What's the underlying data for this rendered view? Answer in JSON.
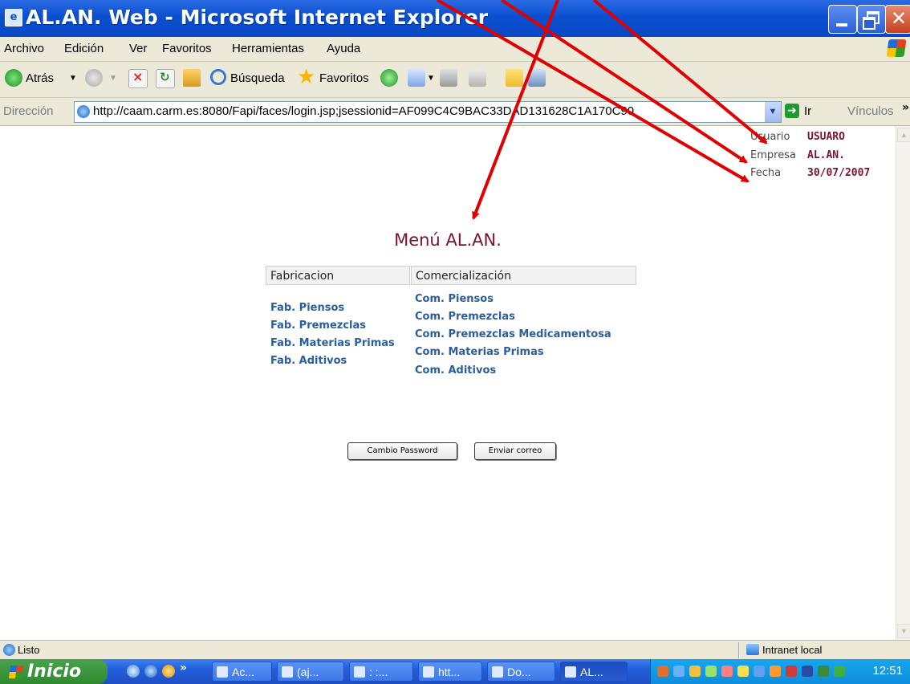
{
  "window": {
    "title": "AL.AN. Web - Microsoft Internet Explorer",
    "icon": "ie-page-icon"
  },
  "menubar": [
    "Archivo",
    "Edición",
    "Ver",
    "Favoritos",
    "Herramientas",
    "Ayuda"
  ],
  "toolbar": {
    "back": "Atrás",
    "search": "Búsqueda",
    "favorites": "Favoritos"
  },
  "addressbar": {
    "label": "Dirección",
    "url": "http://caam.carm.es:8080/Fapi/faces/login.jsp;jsessionid=AF099C4C9BAC33DAD131628C1A170C90",
    "go": "Ir",
    "links": "Vínculos",
    "chevron": "»"
  },
  "userinfo": {
    "usuario_label": "Usuario",
    "usuario_value": "USUARO",
    "empresa_label": "Empresa",
    "empresa_value": "AL.AN.",
    "fecha_label": "Fecha",
    "fecha_value": "30/07/2007"
  },
  "page": {
    "title": "Menú AL.AN.",
    "columns": [
      {
        "header": "Fabricacion",
        "links": [
          "Fab. Piensos",
          "Fab. Premezclas",
          "Fab. Materias Primas",
          "Fab. Aditivos"
        ]
      },
      {
        "header": "Comercialización",
        "links": [
          "Com. Piensos",
          "Com. Premezclas",
          "Com. Premezclas Medicamentosa",
          "Com. Materias Primas",
          "Com. Aditivos"
        ]
      }
    ],
    "buttons": {
      "password": "Cambio Password",
      "mail": "Enviar correo"
    }
  },
  "statusbar": {
    "status": "Listo",
    "zone": "Intranet local"
  },
  "taskbar": {
    "start": "Inicio",
    "quicklaunch_more": "»",
    "tasks": [
      "Ac...",
      "(aj...",
      ": :...",
      "htt...",
      "Do...",
      "AL..."
    ],
    "clock": "12:51"
  },
  "colors": {
    "accent": "#7a1330",
    "link": "#2a5e9c",
    "xp_blue": "#0a4fd0",
    "annotation_arrow": "#e00000"
  }
}
